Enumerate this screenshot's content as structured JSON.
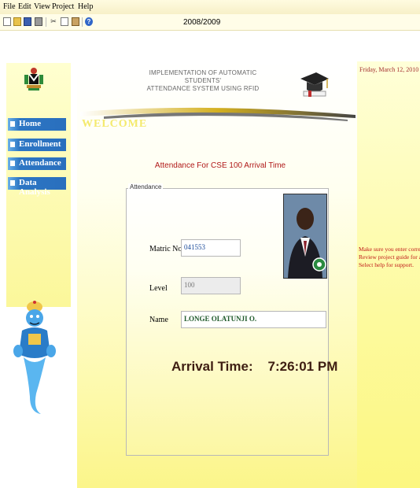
{
  "menu": [
    "File",
    "Edit",
    "View",
    "Project",
    "Help"
  ],
  "toolbar": {
    "icons": [
      "new-document-icon",
      "open-folder-icon",
      "save-icon",
      "print-icon",
      "cut-icon",
      "copy-icon",
      "paste-icon",
      "help-icon"
    ],
    "session": "2008/2009"
  },
  "banner": {
    "title_line1": "IMPLEMENTATION OF AUTOMATIC STUDENTS'",
    "title_line2": "ATTENDANCE SYSTEM USING RFID",
    "welcome": "WELCOME"
  },
  "sidebar": {
    "items": [
      {
        "label": "Home"
      },
      {
        "label": "Enrollment"
      },
      {
        "label": "Attendance"
      },
      {
        "label": "Data Analysis"
      }
    ]
  },
  "attendance": {
    "heading": "Attendance For CSE 100 Arrival Time",
    "legend": "Attendance",
    "matric_label": "Matric No",
    "matric_value": "041553",
    "level_label": "Level",
    "level_value": "100",
    "name_label": "Name",
    "name_value": "LONGE OLATUNJI O.",
    "arrival_label": "Arrival Time:",
    "arrival_value": "7:26:01 PM"
  },
  "right_panel": {
    "date": "Friday, March 12, 2010",
    "tip_line1": "Make sure you enter correct d",
    "tip_line2": "Review project guide for assist",
    "tip_line3": "Select help for support."
  },
  "colors": {
    "nav_blue": "#2a6fbd",
    "heading_red": "#b01818",
    "arrival_brown": "#3e1e12",
    "panel_yellow": "#fdfa9e"
  }
}
